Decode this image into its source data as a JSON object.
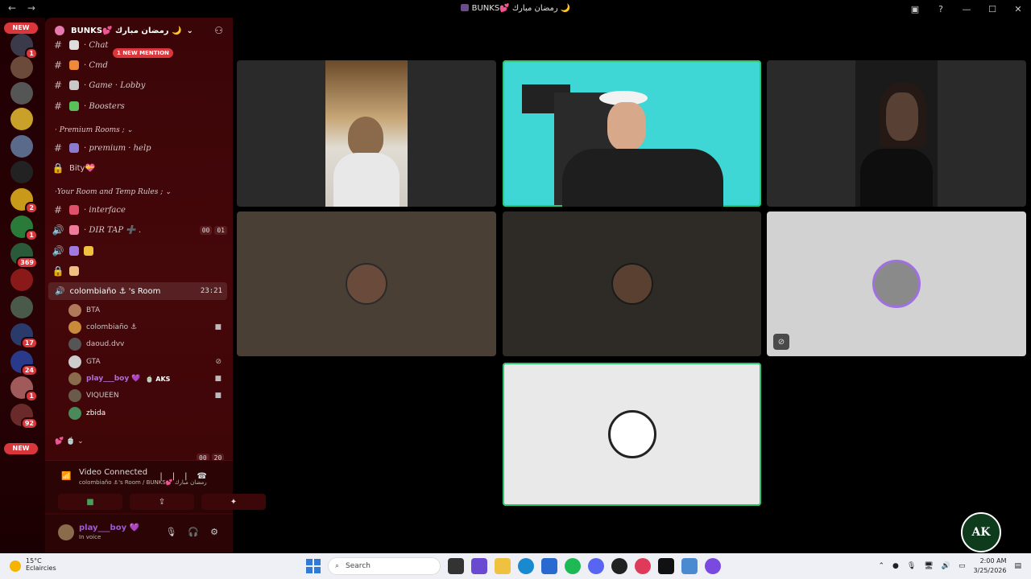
{
  "window": {
    "title": "BUNKS💕 رمضان مبارك 🌙",
    "back": "←",
    "forward": "→",
    "controls": [
      "▣",
      "?",
      "—",
      "☐",
      "✕"
    ]
  },
  "rail": {
    "new_top": "NEW",
    "new_bottom": "NEW",
    "badges": [
      "1",
      "2",
      "1",
      "369",
      "17",
      "24",
      "1",
      "92"
    ]
  },
  "server": {
    "name": "BUNKS💕 رمضان مبارك 🌙",
    "mention_pill": "1 NEW MENTION",
    "channels_top": [
      {
        "label": "· Chat"
      },
      {
        "label": "· Cmd"
      },
      {
        "label": "· Game · Lobby"
      },
      {
        "label": "· Boosters"
      }
    ],
    "category_premium": "· Premium Rooms ;",
    "premium_help": "· premium · help",
    "bity": "Bity💝",
    "category_rules": "·Your Room and Temp Rules ;",
    "interface": "· interface",
    "dir_tap": "· DIR TAP ➕ .",
    "dir_tap_timer": [
      "00",
      "01"
    ],
    "bottom_timer": [
      "00",
      "20"
    ],
    "room": {
      "label": "colombiaño ⚓ 's Room",
      "time": "23:21"
    },
    "members": [
      {
        "name": "BTA",
        "icon": ""
      },
      {
        "name": "colombiaño ⚓",
        "icon": "■"
      },
      {
        "name": "daoud.dvv",
        "icon": ""
      },
      {
        "name": "GTA",
        "icon": "⊘"
      },
      {
        "name": "play___boy 💜",
        "tag": "🍵 AKS",
        "icon": "■"
      },
      {
        "name": "VIQUEEN",
        "icon": "■"
      },
      {
        "name": "zbida",
        "icon": ""
      }
    ]
  },
  "voice": {
    "status": "Video Connected",
    "subtitle": "colombiaño ⚓'s Room / BUNKS💕 رمضان مبارك",
    "buttons": [
      "■",
      "⇪",
      "✦"
    ]
  },
  "user": {
    "name": "play___boy 💜",
    "status": "In voice"
  },
  "badge_logo": "AK",
  "taskbar": {
    "temp": "15°C",
    "condition": "Eclaircies",
    "search": "Search",
    "time": "2:00 AM",
    "date": "3/25/2026"
  }
}
